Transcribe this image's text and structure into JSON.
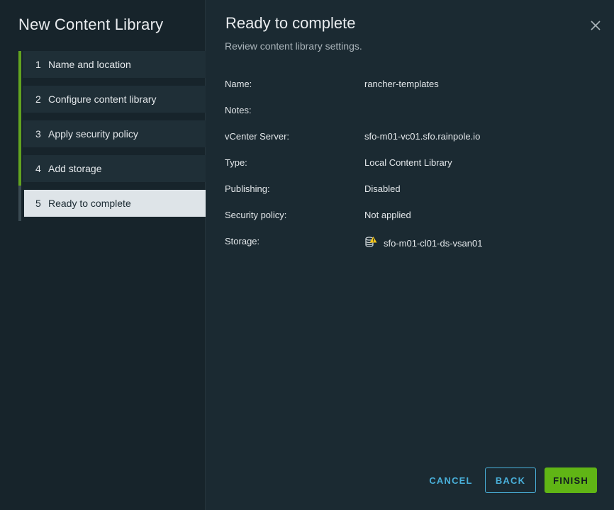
{
  "wizard": {
    "title": "New Content Library",
    "steps": [
      {
        "number": "1",
        "label": "Name and location",
        "status": "completed"
      },
      {
        "number": "2",
        "label": "Configure content library",
        "status": "completed"
      },
      {
        "number": "3",
        "label": "Apply security policy",
        "status": "completed"
      },
      {
        "number": "4",
        "label": "Add storage",
        "status": "completed"
      },
      {
        "number": "5",
        "label": "Ready to complete",
        "status": "current"
      }
    ]
  },
  "page": {
    "title": "Ready to complete",
    "subtitle": "Review content library settings.",
    "close_icon": "close-icon"
  },
  "summary": {
    "name_label": "Name:",
    "name_value": "rancher-templates",
    "notes_label": "Notes:",
    "notes_value": "",
    "vcenter_label": "vCenter Server:",
    "vcenter_value": "sfo-m01-vc01.sfo.rainpole.io",
    "type_label": "Type:",
    "type_value": "Local Content Library",
    "publishing_label": "Publishing:",
    "publishing_value": "Disabled",
    "security_label": "Security policy:",
    "security_value": "Not applied",
    "storage_label": "Storage:",
    "storage_value": "sfo-m01-cl01-ds-vsan01",
    "storage_icon": "datastore-warning-icon"
  },
  "footer": {
    "cancel_label": "CANCEL",
    "back_label": "BACK",
    "finish_label": "FINISH"
  },
  "colors": {
    "accent_green": "#60b515",
    "link_blue": "#49afd9",
    "background": "#1b2a32",
    "sidebar": "#17242b",
    "warning": "#f5c518"
  }
}
